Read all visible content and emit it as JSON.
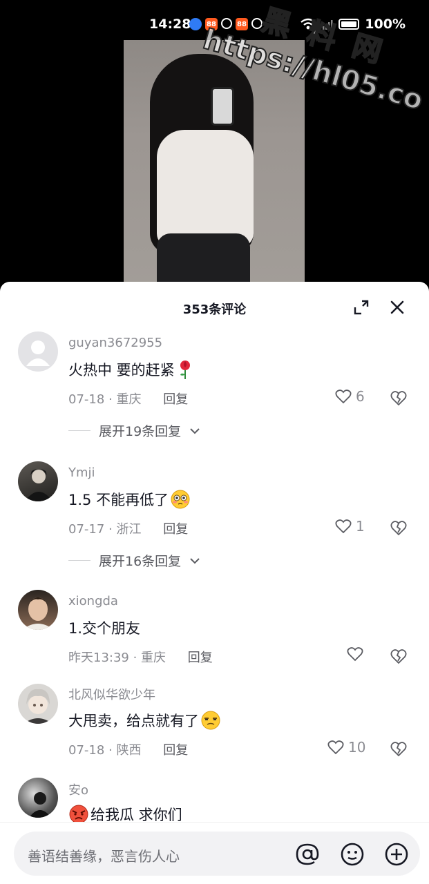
{
  "status_bar": {
    "time": "14:28",
    "battery": "100%",
    "app_icons": [
      "browser-icon",
      "app-badge-icon",
      "hotspot-icon",
      "app-badge-icon",
      "sync-icon"
    ]
  },
  "watermark": {
    "line1": "黑料网",
    "line2": "https://hl05.co"
  },
  "sheet": {
    "title": "353条评论"
  },
  "comments": [
    {
      "user": "guyan3672955",
      "text": "火热中 要的赶紧",
      "emoji": "rose-emoji",
      "date": "07-18",
      "location": "重庆",
      "reply_label": "回复",
      "likes": "6",
      "expand": "展开19条回复"
    },
    {
      "user": "Ymji",
      "text": "1.5 不能再低了",
      "emoji": "flushed-face-emoji",
      "date": "07-17",
      "location": "浙江",
      "reply_label": "回复",
      "likes": "1",
      "expand": "展开16条回复"
    },
    {
      "user": "xiongda",
      "text": "1.交个朋友",
      "emoji": "",
      "date": "昨天13:39",
      "location": "重庆",
      "reply_label": "回复",
      "likes": ""
    },
    {
      "user": "北风似华欲少年",
      "text": "大甩卖，给点就有了",
      "emoji": "unamused-face-emoji",
      "date": "07-18",
      "location": "陕西",
      "reply_label": "回复",
      "likes": "10"
    },
    {
      "user": "安o",
      "text": "给我瓜 求你们",
      "emoji": "angry-face-emoji"
    }
  ],
  "input": {
    "placeholder": "善语结善缘，恶言伤人心"
  },
  "colors": {
    "text_primary": "#161823",
    "text_secondary": "#8a8b91",
    "sheet_bg": "#ffffff",
    "input_bg": "#f2f2f4"
  }
}
